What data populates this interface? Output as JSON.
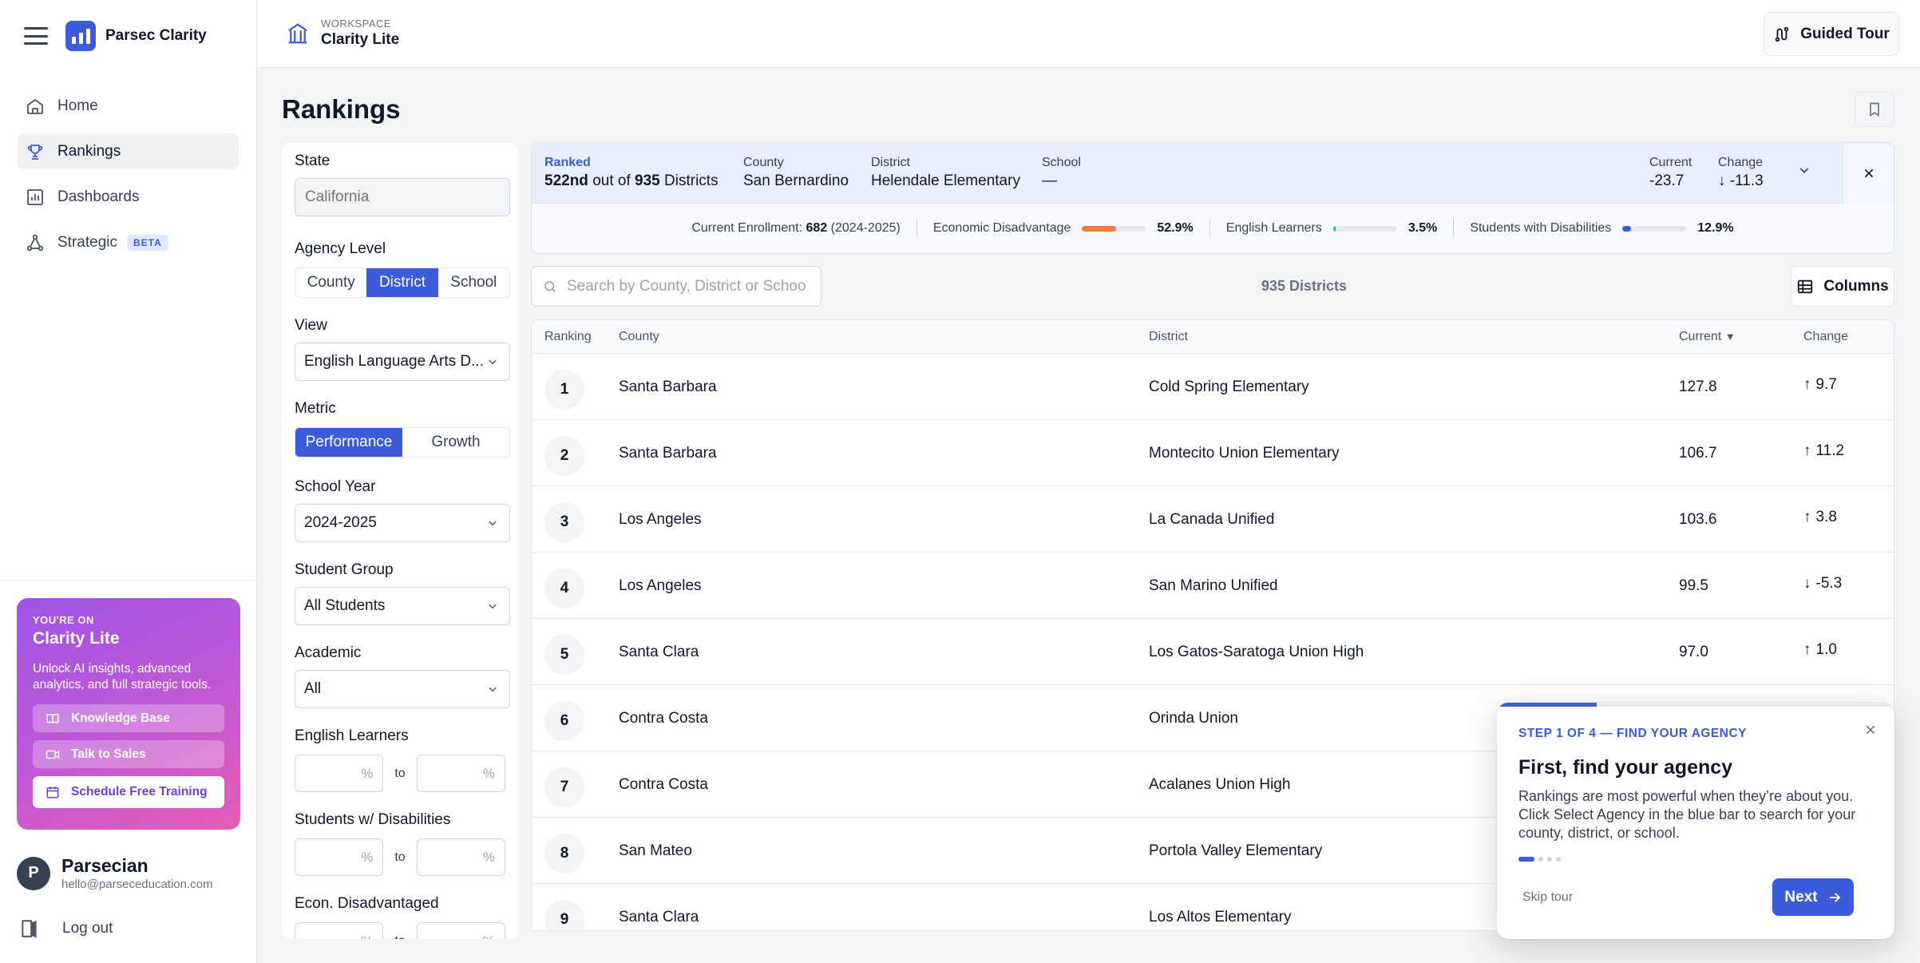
{
  "app": {
    "name": "Parsec Clarity"
  },
  "sidebar": {
    "items": [
      {
        "label": "Home",
        "icon": "home-icon"
      },
      {
        "label": "Rankings",
        "icon": "trophy-icon",
        "active": true
      },
      {
        "label": "Dashboards",
        "icon": "chart-icon"
      },
      {
        "label": "Strategic",
        "icon": "network-icon",
        "badge": "BETA"
      }
    ],
    "promo": {
      "kicker": "YOU'RE ON",
      "title": "Clarity Lite",
      "text": "Unlock AI insights, advanced analytics, and full strategic tools.",
      "btn_kb": "Knowledge Base",
      "btn_sales": "Talk to Sales",
      "btn_training": "Schedule Free Training"
    },
    "user": {
      "initial": "P",
      "name": "Parsecian",
      "email": "hello@parseceducation.com"
    },
    "logout": "Log out"
  },
  "topbar": {
    "workspace_kicker": "WORKSPACE",
    "workspace_name": "Clarity Lite",
    "tour_label": "Guided Tour"
  },
  "page": {
    "title": "Rankings"
  },
  "filters": {
    "state_label": "State",
    "state_placeholder": "California",
    "agency_label": "Agency Level",
    "agency_options": [
      "County",
      "District",
      "School"
    ],
    "agency_selected": "District",
    "view_label": "View",
    "view_value": "English Language Arts D...",
    "metric_label": "Metric",
    "metric_options": [
      "Performance",
      "Growth"
    ],
    "metric_selected": "Performance",
    "year_label": "School Year",
    "year_value": "2024-2025",
    "group_label": "Student Group",
    "group_value": "All Students",
    "academic_label": "Academic",
    "academic_value": "All",
    "el_label": "English Learners",
    "swd_label": "Students w/ Disabilities",
    "econ_label": "Econ. Disadvantaged",
    "pct": "%",
    "to": "to"
  },
  "ranked": {
    "ranked_label": "Ranked",
    "rank": "522nd",
    "out_of": "out of",
    "total": "935",
    "unit": "Districts",
    "county_label": "County",
    "county_value": "San Bernardino",
    "district_label": "District",
    "district_value": "Helendale Elementary",
    "school_label": "School",
    "school_value": "—",
    "current_label": "Current",
    "current_value": "-23.7",
    "change_label": "Change",
    "change_value": "-11.3",
    "enrollment_label": "Current Enrollment:",
    "enrollment_value": "682",
    "enrollment_year": "(2024-2025)",
    "econ_label": "Economic Disadvantage",
    "econ_value": "52.9%",
    "econ_fraction": 0.529,
    "el_label": "English Learners",
    "el_value": "3.5%",
    "el_fraction": 0.035,
    "swd_label": "Students with Disabilities",
    "swd_value": "12.9%",
    "swd_fraction": 0.129,
    "colors": {
      "econ": "#f47b3b",
      "el": "#14b8a6",
      "swd": "#3b5bdb"
    }
  },
  "search": {
    "placeholder": "Search by County, District or School"
  },
  "count_label": "935 Districts",
  "columns_label": "Columns",
  "table": {
    "headers": {
      "ranking": "Ranking",
      "county": "County",
      "district": "District",
      "current": "Current",
      "change": "Change"
    },
    "rows": [
      {
        "rank": "1",
        "county": "Santa Barbara",
        "district": "Cold Spring Elementary",
        "current": "127.8",
        "change": "9.7",
        "dir": "up"
      },
      {
        "rank": "2",
        "county": "Santa Barbara",
        "district": "Montecito Union Elementary",
        "current": "106.7",
        "change": "11.2",
        "dir": "up"
      },
      {
        "rank": "3",
        "county": "Los Angeles",
        "district": "La Canada Unified",
        "current": "103.6",
        "change": "3.8",
        "dir": "up"
      },
      {
        "rank": "4",
        "county": "Los Angeles",
        "district": "San Marino Unified",
        "current": "99.5",
        "change": "-5.3",
        "dir": "down"
      },
      {
        "rank": "5",
        "county": "Santa Clara",
        "district": "Los Gatos-Saratoga Union High",
        "current": "97.0",
        "change": "1.0",
        "dir": "up"
      },
      {
        "rank": "6",
        "county": "Contra Costa",
        "district": "Orinda Union",
        "current": "",
        "change": "",
        "dir": ""
      },
      {
        "rank": "7",
        "county": "Contra Costa",
        "district": "Acalanes Union High",
        "current": "",
        "change": "",
        "dir": ""
      },
      {
        "rank": "8",
        "county": "San Mateo",
        "district": "Portola Valley Elementary",
        "current": "",
        "change": "",
        "dir": ""
      },
      {
        "rank": "9",
        "county": "Santa Clara",
        "district": "Los Altos Elementary",
        "current": "",
        "change": "",
        "dir": ""
      }
    ]
  },
  "tour": {
    "step": "STEP 1 OF 4 — FIND YOUR AGENCY",
    "title": "First, find your agency",
    "text": "Rankings are most powerful when they’re about you. Click Select Agency in the blue bar to search for your county, district, or school.",
    "skip": "Skip tour",
    "next": "Next",
    "progress": 0.25
  }
}
